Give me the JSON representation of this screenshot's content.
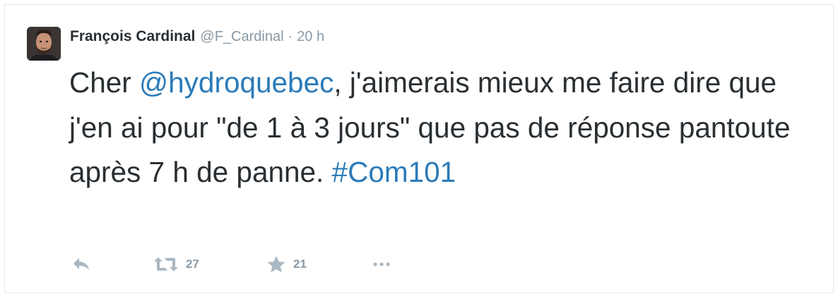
{
  "tweet": {
    "author": {
      "name": "François Cardinal",
      "screen_name": "@F_Cardinal"
    },
    "separator": "·",
    "time": "20 h",
    "text": {
      "part1": "Cher ",
      "mention": "@hydroquebec",
      "part2": ", j'aimerais mieux me faire dire que j'en ai pour \"de 1 à 3 jours\" que pas de réponse pantoute après 7 h de panne. ",
      "hashtag": "#Com101"
    },
    "stats": {
      "retweets": "27",
      "favorites": "21"
    }
  },
  "colors": {
    "text": "#292f33",
    "muted": "#8899a6",
    "link": "#2b7bb9",
    "border": "#e1e8ed"
  },
  "icons": [
    "reply-icon",
    "retweet-icon",
    "star-icon",
    "more-icon"
  ]
}
